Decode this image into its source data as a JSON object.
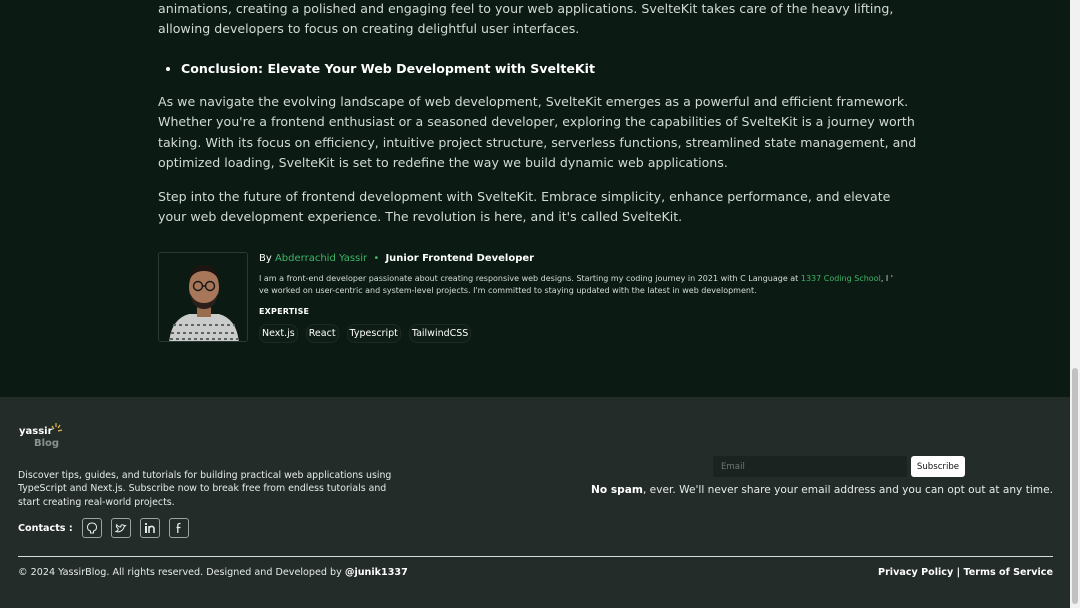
{
  "article": {
    "p_animations": "animations, creating a polished and engaging feel to your web applications. SvelteKit takes care of the heavy lifting, allowing developers to focus on creating delightful user interfaces.",
    "bullet_heading": "Conclusion: Elevate Your Web Development with SvelteKit",
    "p_conclusion": "As we navigate the evolving landscape of web development, SvelteKit emerges as a powerful and efficient framework. Whether you're a frontend enthusiast or a seasoned developer, exploring the capabilities of SvelteKit is a journey worth taking. With its focus on efficiency, intuitive project structure, serverless functions, streamlined state management, and optimized loading, SvelteKit is set to redefine the way we build dynamic web applications.",
    "p_step": "Step into the future of frontend development with SvelteKit. Embrace simplicity, enhance performance, and elevate your web development experience. The revolution is here, and it's called SvelteKit."
  },
  "author": {
    "by": "By",
    "name": "Abderrachid Yassir",
    "separator": "•",
    "role": "Junior Frontend Developer",
    "bio_part1": "I am a front-end developer passionate about creating responsive web designs. Starting my coding journey in 2021 with C Language at ",
    "bio_link": "1337 Coding School",
    "bio_part2": ", I ' ve worked on user-centric and system-level projects. I'm committed to staying updated with the latest in web development.",
    "expertise_title": "EXPERTISE",
    "tags": [
      "Next.js",
      "React",
      "Typescript",
      "TailwindCSS"
    ]
  },
  "footer": {
    "logo_text_1": "yassir",
    "logo_text_2": "Blog",
    "description": "Discover tips, guides, and tutorials for building practical web applications using TypeScript and Next.js. Subscribe now to break free from endless tutorials and start creating real-world projects.",
    "contacts_label": "Contacts :",
    "social_icons": [
      "github-icon",
      "twitter-icon",
      "linkedin-icon",
      "facebook-icon"
    ],
    "email_placeholder": "Email",
    "subscribe_label": "Subscribe",
    "no_spam_bold": "No spam",
    "no_spam_rest": ", ever. We'll never share your email address and you can opt out at any time.",
    "copyright": "© 2024 YassirBlog. All rights reserved. Designed and Developed by ",
    "copyright_handle": "@junik1337",
    "privacy": "Privacy Policy",
    "legal_sep": "|",
    "terms": "Terms of Service"
  },
  "colors": {
    "page_bg": "#0b1a13",
    "footer_bg": "#242c29",
    "accent": "#3fb667"
  }
}
